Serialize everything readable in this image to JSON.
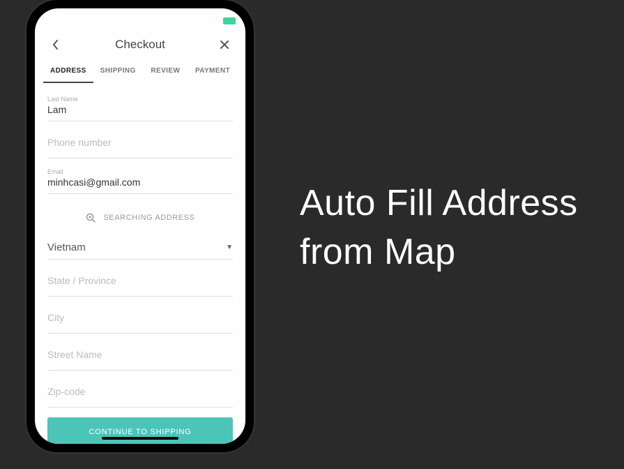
{
  "header": {
    "title": "Checkout"
  },
  "tabs": {
    "address": "ADDRESS",
    "shipping": "SHIPPING",
    "review": "REVIEW",
    "payment": "PAYMENT"
  },
  "fields": {
    "lastname_label": "Last Name",
    "lastname_value": "Lam",
    "phone_placeholder": "Phone number",
    "email_label": "Email",
    "email_value": "minhcasi@gmail.com",
    "searching_label": "SEARCHING ADDRESS",
    "country_value": "Vietnam",
    "state_placeholder": "State / Province",
    "city_placeholder": "City",
    "street_placeholder": "Street Name",
    "zip_placeholder": "Zip-code"
  },
  "cta": {
    "label": "CONTINUE TO SHIPPING"
  },
  "hero": {
    "line1": "Auto Fill Address",
    "line2": "from Map"
  }
}
